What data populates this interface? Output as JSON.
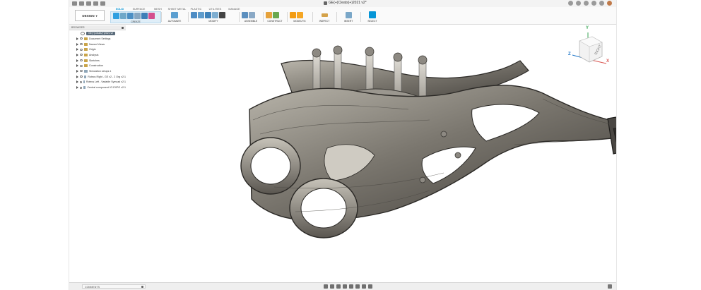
{
  "window": {
    "title": "GE(+)Cleats(+)2021 v2*"
  },
  "ribbon": {
    "workspace": "DESIGN",
    "tabs": [
      "SOLID",
      "SURFACE",
      "MESH",
      "SHEET METAL",
      "PLASTIC",
      "UTILITIES",
      "MANAGE"
    ],
    "active_tab": "SOLID",
    "groups": {
      "create": "CREATE",
      "automate": "AUTOMATE",
      "modify": "MODIFY",
      "assemble": "ASSEMBLE",
      "construct": "CONSTRUCT",
      "modelfix": "MODELFIX",
      "inspect": "INSPECT",
      "insert": "INSERT",
      "select": "SELECT"
    }
  },
  "browser": {
    "header": "BROWSER",
    "root": "GE(+)Cleats(+)2021 v2",
    "items": [
      {
        "label": "Document Settings"
      },
      {
        "label": "Named Views"
      },
      {
        "label": "Origin"
      },
      {
        "label": "Analysis"
      },
      {
        "label": "Sketches"
      },
      {
        "label": "Construction"
      },
      {
        "label": "Simulation setups 1"
      },
      {
        "label": "Rotecs Right - GE v2 - 2 Org v2:1"
      },
      {
        "label": "Rotecs Left - Variable Symcad v2:1"
      },
      {
        "label": "Central component V3 EXPO v2:1"
      }
    ]
  },
  "viewcube": {
    "face": "RIGHT",
    "axis_z": "Z",
    "axis_x": "X",
    "axis_y": "Y"
  },
  "bottom": {
    "comments": "COMMENTS"
  },
  "colors": {
    "accent": "#0696d7",
    "part_body": "#6e6a63",
    "part_highlight": "#b9b5ab",
    "part_shadow": "#3c3935"
  },
  "icons": [
    "search-icon",
    "gear-icon",
    "pin-icon",
    "eye-icon",
    "folder-icon",
    "orbit-icon",
    "pan-icon",
    "zoom-icon",
    "fit-icon",
    "display-settings-icon",
    "grid-icon"
  ]
}
